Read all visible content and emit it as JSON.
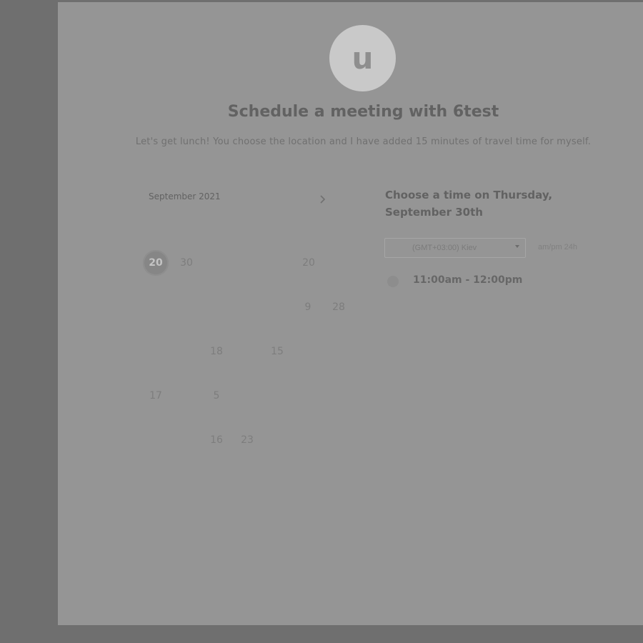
{
  "header": {
    "avatar_letter": "u",
    "title": "Schedule a meeting with 6test",
    "subtitle": "Let's get lunch! You choose the location and I have added 15 minutes of travel time for myself."
  },
  "calendar": {
    "month_label": "September 2021",
    "next_icon": "chevron-right-icon",
    "days": [
      {
        "label": "20",
        "selected": true
      },
      {
        "label": "30"
      },
      {
        "label": "20"
      },
      {
        "label": "9"
      },
      {
        "label": "28"
      },
      {
        "label": "18"
      },
      {
        "label": "15"
      },
      {
        "label": "17"
      },
      {
        "label": "5"
      },
      {
        "label": "16"
      },
      {
        "label": "23"
      }
    ]
  },
  "times": {
    "heading": "Choose a time on Thursday, September 30th",
    "timezone": "(GMT+03:00) Kiev",
    "format_toggle": "am/pm  24h",
    "slots": [
      {
        "label": "11:00am - 12:00pm"
      }
    ]
  }
}
